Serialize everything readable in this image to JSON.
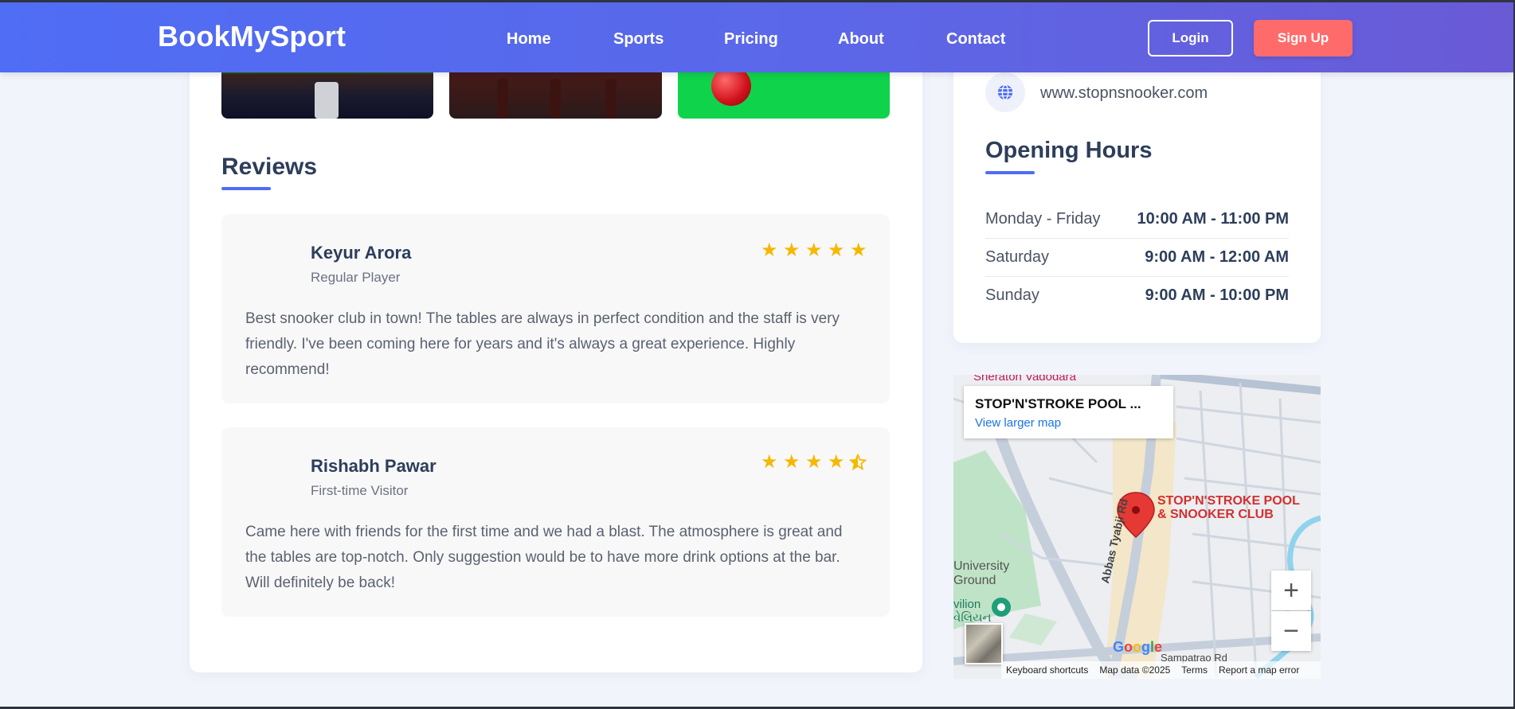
{
  "nav": {
    "brand": "BookMySport",
    "links": [
      "Home",
      "Sports",
      "Pricing",
      "About",
      "Contact"
    ],
    "login": "Login",
    "signup": "Sign Up"
  },
  "reviews": {
    "title": "Reviews",
    "items": [
      {
        "name": "Keyur Arora",
        "role": "Regular Player",
        "rating": 5,
        "text": "Best snooker club in town! The tables are always in perfect condition and the staff is very friendly. I've been coming here for years and it's always a great experience. Highly recommend!"
      },
      {
        "name": "Rishabh Pawar",
        "role": "First-time Visitor",
        "rating": 4.5,
        "text": "Came here with friends for the first time and we had a blast. The atmosphere is great and the tables are top-notch. Only suggestion would be to have more drink options at the bar. Will definitely be back!"
      }
    ]
  },
  "contact": {
    "website": "www.stopnsnooker.com"
  },
  "hours": {
    "title": "Opening Hours",
    "rows": [
      {
        "day": "Monday - Friday",
        "time": "10:00 AM - 11:00 PM"
      },
      {
        "day": "Saturday",
        "time": "9:00 AM - 12:00 AM"
      },
      {
        "day": "Sunday",
        "time": "9:00 AM - 10:00 PM"
      }
    ]
  },
  "map": {
    "place_title": "STOP'N'STROKE POOL ...",
    "view_larger": "View larger map",
    "pin_label_1": "STOP'N'STROKE POOL",
    "pin_label_2": "& SNOOKER CLUB",
    "label_sheraton": "Sheraton Vadodara",
    "label_university_1": "University",
    "label_university_2": "Ground",
    "label_pavilion_1": "vilion",
    "label_pavilion_2": "વેલિયન",
    "road_label": "Abbas Tyabji Rd",
    "road_label_2": "Sampatrao Rd",
    "zoom_in": "+",
    "zoom_out": "−",
    "google": "Google",
    "footer": [
      "Keyboard shortcuts",
      "Map data ©2025",
      "Terms",
      "Report a map error"
    ]
  },
  "colors": {
    "accent": "#4f6df5",
    "signup": "#ff6b6b",
    "star": "#f5b800"
  }
}
